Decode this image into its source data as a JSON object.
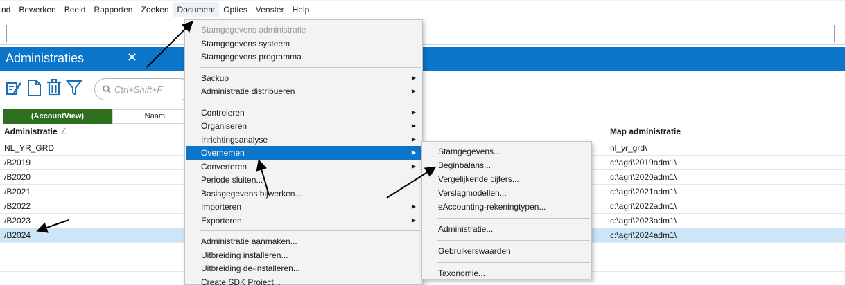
{
  "menubar": {
    "items": [
      {
        "label": "nd",
        "active": false
      },
      {
        "label": "Bewerken",
        "active": false
      },
      {
        "label": "Beeld",
        "active": false
      },
      {
        "label": "Rapporten",
        "active": false
      },
      {
        "label": "Zoeken",
        "active": false
      },
      {
        "label": "Document",
        "active": true
      },
      {
        "label": "Opties",
        "active": false
      },
      {
        "label": "Venster",
        "active": false
      },
      {
        "label": "Help",
        "active": false
      }
    ]
  },
  "panel": {
    "title": "Administraties",
    "close_glyph": "✕",
    "accent": "#0a75c9"
  },
  "toolbar": {
    "icons": [
      "edit-icon",
      "new-document-icon",
      "delete-icon",
      "filter-icon"
    ],
    "search_placeholder": "Ctrl+Shift+F"
  },
  "columns": {
    "tab_accountview": "(AccountView)",
    "tab_naam": "Naam",
    "header_administratie": "Administratie",
    "header_sort_glyph": "∠",
    "header_map": "Map administratie"
  },
  "rows": [
    {
      "admin": "NL_YR_GRD",
      "map": "nl_yr_grd\\",
      "selected": false
    },
    {
      "admin": "/B2019",
      "map": "c:\\agri\\2019adm1\\",
      "selected": false
    },
    {
      "admin": "/B2020",
      "map": "c:\\agri\\2020adm1\\",
      "selected": false
    },
    {
      "admin": "/B2021",
      "map": "c:\\agri\\2021adm1\\",
      "selected": false
    },
    {
      "admin": "/B2022",
      "map": "c:\\agri\\2022adm1\\",
      "selected": false
    },
    {
      "admin": "/B2023",
      "map": "c:\\agri\\2023adm1\\",
      "selected": false
    },
    {
      "admin": "/B2024",
      "map": "c:\\agri\\2024adm1\\",
      "selected": true
    }
  ],
  "document_menu": {
    "groups": [
      [
        {
          "label": "Stamgegevens administratie",
          "disabled": true,
          "submenu": false,
          "highlighted": false
        },
        {
          "label": "Stamgegevens systeem",
          "disabled": false,
          "submenu": false,
          "highlighted": false
        },
        {
          "label": "Stamgegevens programma",
          "disabled": false,
          "submenu": false,
          "highlighted": false
        }
      ],
      [
        {
          "label": "Backup",
          "disabled": false,
          "submenu": true,
          "highlighted": false
        },
        {
          "label": "Administratie distribueren",
          "disabled": false,
          "submenu": true,
          "highlighted": false
        }
      ],
      [
        {
          "label": "Controleren",
          "disabled": false,
          "submenu": true,
          "highlighted": false
        },
        {
          "label": "Organiseren",
          "disabled": false,
          "submenu": true,
          "highlighted": false
        },
        {
          "label": "Inrichtingsanalyse",
          "disabled": false,
          "submenu": true,
          "highlighted": false
        },
        {
          "label": "Overnemen",
          "disabled": false,
          "submenu": true,
          "highlighted": true
        },
        {
          "label": "Converteren",
          "disabled": false,
          "submenu": true,
          "highlighted": false
        },
        {
          "label": "Periode sluiten...",
          "disabled": false,
          "submenu": false,
          "highlighted": false
        },
        {
          "label": "Basisgegevens bijwerken...",
          "disabled": false,
          "submenu": false,
          "highlighted": false
        },
        {
          "label": "Importeren",
          "disabled": false,
          "submenu": true,
          "highlighted": false
        },
        {
          "label": "Exporteren",
          "disabled": false,
          "submenu": true,
          "highlighted": false
        }
      ],
      [
        {
          "label": "Administratie aanmaken...",
          "disabled": false,
          "submenu": false,
          "highlighted": false
        },
        {
          "label": "Uitbreiding installeren...",
          "disabled": false,
          "submenu": false,
          "highlighted": false
        },
        {
          "label": "Uitbreiding de-installeren...",
          "disabled": false,
          "submenu": false,
          "highlighted": false
        },
        {
          "label": "Create SDK Project...",
          "disabled": false,
          "submenu": false,
          "highlighted": false
        }
      ]
    ]
  },
  "overnemen_submenu": {
    "groups": [
      [
        {
          "label": "Stamgegevens..."
        },
        {
          "label": "Beginbalans..."
        },
        {
          "label": "Vergelijkende cijfers..."
        },
        {
          "label": "Verslagmodellen..."
        },
        {
          "label": "eAccounting-rekeningtypen..."
        }
      ],
      [
        {
          "label": "Administratie..."
        }
      ],
      [
        {
          "label": "Gebruikerswaarden"
        }
      ],
      [
        {
          "label": "Taxonomie..."
        }
      ]
    ]
  },
  "submenu_arrow_glyph": "▶",
  "colors": {
    "accent_blue": "#0a75c9",
    "green_tab": "#2e6f1f",
    "icon_blue": "#1a6fb5",
    "selected_row": "#cce5f7",
    "menu_bg": "#f3f3f3"
  }
}
